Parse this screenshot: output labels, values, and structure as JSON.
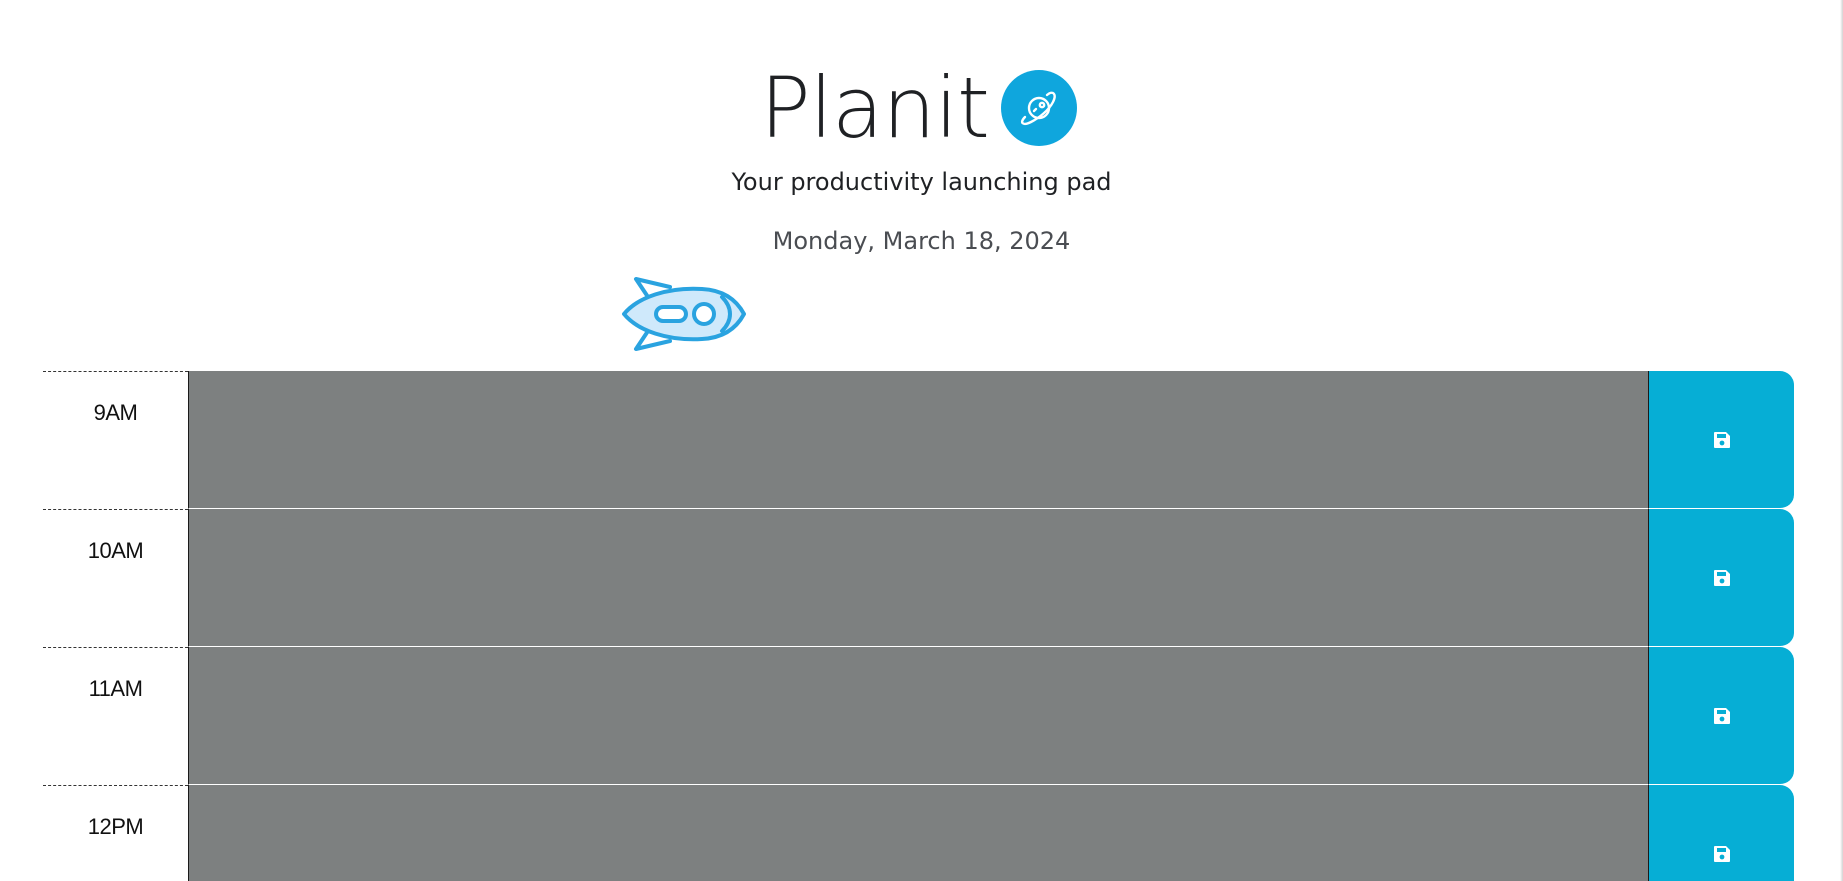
{
  "header": {
    "title": "Planit",
    "tagline": "Your productivity launching pad",
    "date": "Monday, March 18, 2024"
  },
  "icons": {
    "logo": "planet-icon",
    "decoration": "rocket-icon",
    "save": "save-icon"
  },
  "colors": {
    "accent": "#06aed5",
    "timeblock_past": "#7d8080",
    "title_text": "#1f2124"
  },
  "timeblocks": [
    {
      "hour": "9AM",
      "text": ""
    },
    {
      "hour": "10AM",
      "text": ""
    },
    {
      "hour": "11AM",
      "text": ""
    },
    {
      "hour": "12PM",
      "text": ""
    }
  ]
}
